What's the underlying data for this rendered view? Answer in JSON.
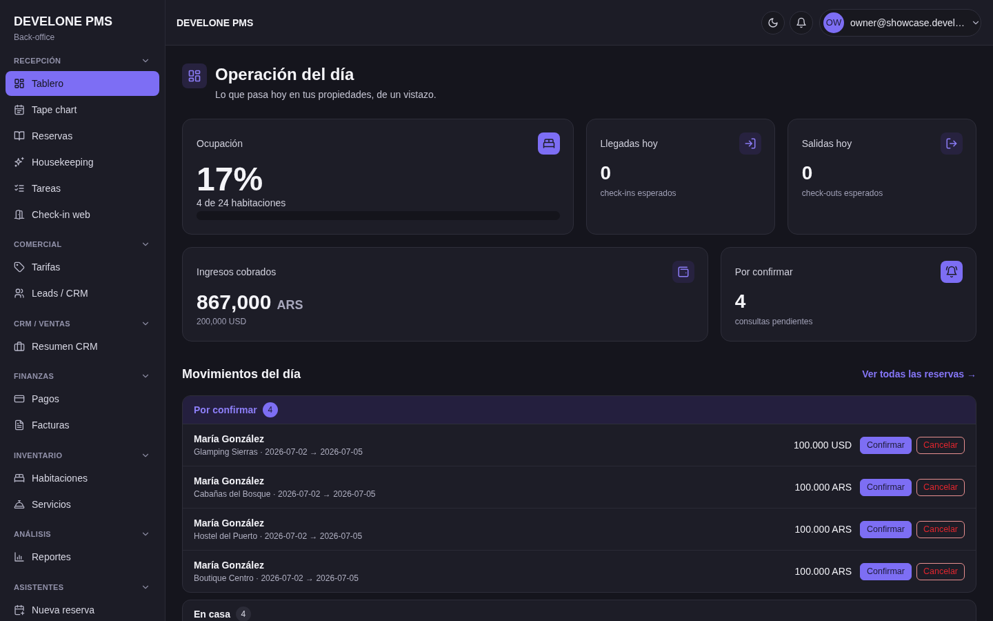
{
  "sidebar": {
    "brand": "DEVELONE PMS",
    "subtitle": "Back-office",
    "sections": [
      {
        "title": "RECEPCIÓN",
        "expanded": true,
        "items": [
          {
            "label": "Tablero",
            "selected": true
          },
          {
            "label": "Tape chart",
            "selected": false
          },
          {
            "label": "Reservas",
            "selected": false
          },
          {
            "label": "Housekeeping",
            "selected": false
          },
          {
            "label": "Tareas",
            "selected": false
          },
          {
            "label": "Check-in web",
            "selected": false
          }
        ]
      },
      {
        "title": "COMERCIAL",
        "expanded": true,
        "items": [
          {
            "label": "Tarifas",
            "selected": false
          },
          {
            "label": "Leads / CRM",
            "selected": false
          }
        ]
      },
      {
        "title": "CRM / VENTAS",
        "expanded": true,
        "items": [
          {
            "label": "Resumen CRM",
            "selected": false
          }
        ]
      },
      {
        "title": "FINANZAS",
        "expanded": true,
        "items": [
          {
            "label": "Pagos",
            "selected": false
          },
          {
            "label": "Facturas",
            "selected": false
          }
        ]
      },
      {
        "title": "INVENTARIO",
        "expanded": true,
        "items": [
          {
            "label": "Habitaciones",
            "selected": false
          },
          {
            "label": "Servicios",
            "selected": false
          }
        ]
      },
      {
        "title": "ANÁLISIS",
        "expanded": true,
        "items": [
          {
            "label": "Reportes",
            "selected": false
          }
        ]
      },
      {
        "title": "ASISTENTES",
        "expanded": true,
        "items": [
          {
            "label": "Nueva reserva",
            "selected": false
          }
        ]
      }
    ]
  },
  "topbar": {
    "title": "DEVELONE PMS",
    "user": {
      "initials": "OW",
      "email": "owner@showcase.devel…"
    }
  },
  "page": {
    "title": "Operación del día",
    "subtitle": "Lo que pasa hoy en tus propiedades, de un vistazo."
  },
  "stats": {
    "rows": [
      {
        "cards": [
          {
            "kind": "progress",
            "label": "Ocupación",
            "value": "17%",
            "caption": "4 de 24 habitaciones",
            "highlighted": true
          },
          {
            "kind": "count",
            "label": "Llegadas hoy",
            "value": "0",
            "caption": "check-ins esperados",
            "highlighted": false
          },
          {
            "kind": "count",
            "label": "Salidas hoy",
            "value": "0",
            "caption": "check-outs esperados",
            "highlighted": false
          }
        ]
      },
      {
        "cards": [
          {
            "kind": "amount",
            "label": "Ingresos cobrados",
            "value": "867,000",
            "unit": "ARS",
            "caption": "200,000 USD",
            "highlighted": false
          },
          {
            "kind": "count",
            "label": "Por confirmar",
            "value": "4",
            "caption": "consultas pendientes",
            "highlighted": true
          }
        ]
      }
    ]
  },
  "movements": {
    "title": "Movimientos del día",
    "link": "Ver todas las reservas →",
    "groups": [
      {
        "title": "Por confirmar",
        "count": "4",
        "highlighted": true,
        "rows": [
          {
            "name": "María González",
            "detail": "Glamping Sierras · 2026-07-02 → 2026-07-05",
            "amount": "100.000 USD",
            "actions": [
              {
                "label": "Confirmar",
                "kind": "primary"
              },
              {
                "label": "Cancelar",
                "kind": "danger"
              }
            ]
          },
          {
            "name": "María González",
            "detail": "Cabañas del Bosque · 2026-07-02 → 2026-07-05",
            "amount": "100.000 ARS",
            "actions": [
              {
                "label": "Confirmar",
                "kind": "primary"
              },
              {
                "label": "Cancelar",
                "kind": "danger"
              }
            ]
          },
          {
            "name": "María González",
            "detail": "Hostel del Puerto · 2026-07-02 → 2026-07-05",
            "amount": "100.000 ARS",
            "actions": [
              {
                "label": "Confirmar",
                "kind": "primary"
              },
              {
                "label": "Cancelar",
                "kind": "danger"
              }
            ]
          },
          {
            "name": "María González",
            "detail": "Boutique Centro · 2026-07-02 → 2026-07-05",
            "amount": "100.000 ARS",
            "actions": [
              {
                "label": "Confirmar",
                "kind": "primary"
              },
              {
                "label": "Cancelar",
                "kind": "danger"
              }
            ]
          }
        ]
      },
      {
        "title": "En casa",
        "count": "4",
        "highlighted": false
      }
    ]
  }
}
